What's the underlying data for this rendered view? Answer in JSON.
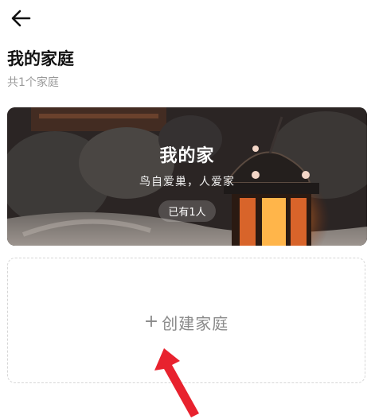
{
  "header": {
    "back_icon": "arrow-left-icon"
  },
  "page": {
    "title": "我的家庭",
    "subtitle": "共1个家庭"
  },
  "family_card": {
    "name": "我的家",
    "motto": "鸟自爱巢，人爱家",
    "members": "已有1人"
  },
  "create": {
    "icon": "plus-icon",
    "plus": "+",
    "label": "创建家庭"
  },
  "colors": {
    "annotation_arrow": "#e8222e",
    "muted_text": "#8a8a8a"
  }
}
